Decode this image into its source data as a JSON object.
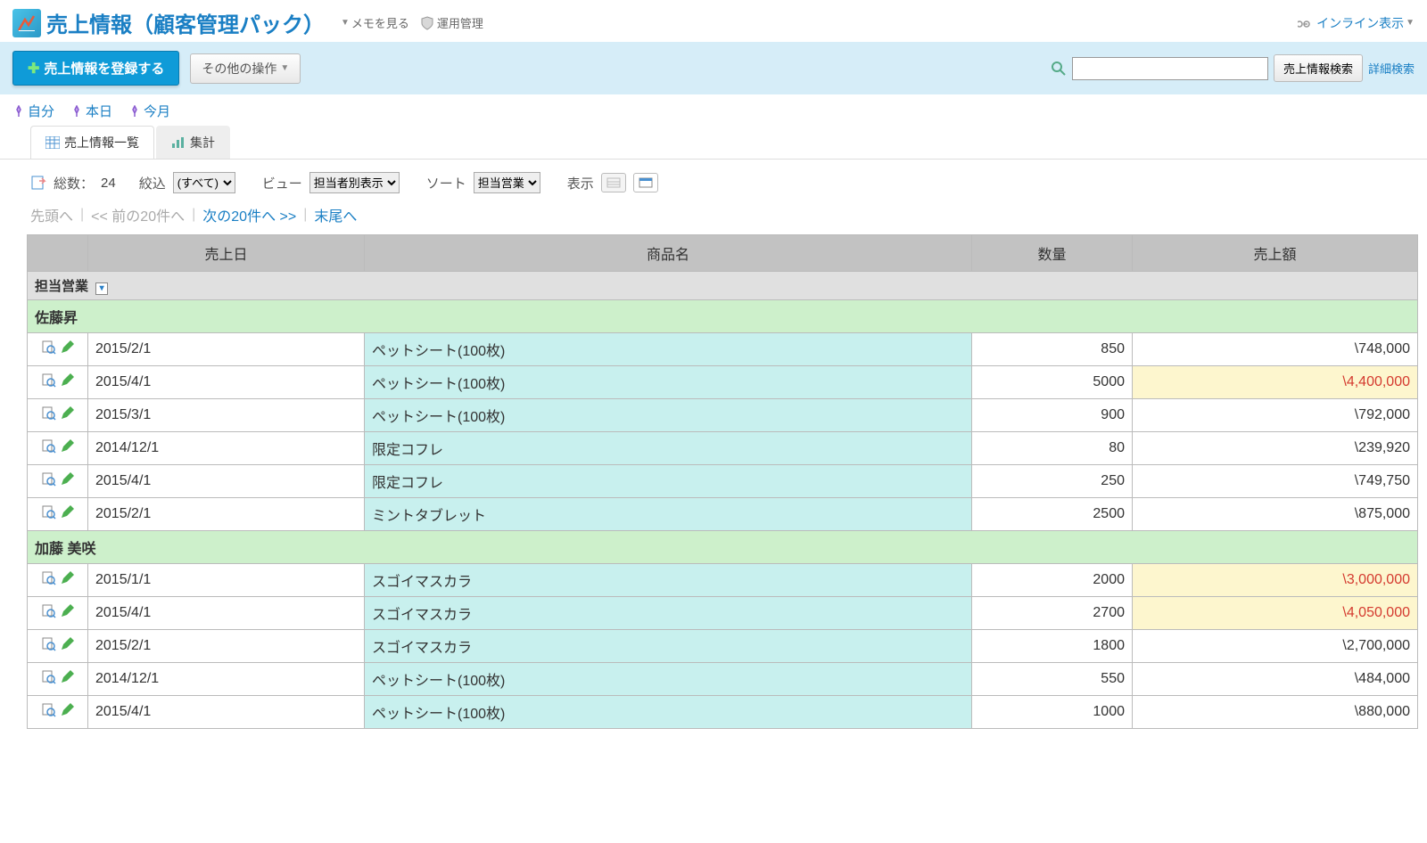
{
  "header": {
    "title": "売上情報（顧客管理パック）",
    "memo_label": "メモを見る",
    "operation_label": "運用管理",
    "inline_label": "インライン表示"
  },
  "toolbar": {
    "register_label": "売上情報を登録する",
    "other_ops_label": "その他の操作",
    "search_button": "売上情報検索",
    "adv_search": "詳細検索"
  },
  "pins": [
    {
      "label": "自分"
    },
    {
      "label": "本日"
    },
    {
      "label": "今月"
    }
  ],
  "tabs": [
    {
      "label": "売上情報一覧"
    },
    {
      "label": "集計"
    }
  ],
  "controls": {
    "total_label": "総数：",
    "total_value": "24",
    "filter_label": "絞込",
    "filter_options": [
      "(すべて)"
    ],
    "view_label": "ビュー",
    "view_options": [
      "担当者別表示"
    ],
    "sort_label": "ソート",
    "sort_options": [
      "担当営業"
    ],
    "display_label": "表示"
  },
  "pager": {
    "first": "先頭へ",
    "prev": "<< 前の20件へ",
    "next": "次の20件へ >>",
    "last": "末尾へ"
  },
  "table": {
    "group_by": "担当営業",
    "columns": [
      "売上日",
      "商品名",
      "数量",
      "売上額"
    ],
    "groups": [
      {
        "name": "佐藤昇",
        "rows": [
          {
            "date": "2015/2/1",
            "product": "ペットシート(100枚)",
            "qty": "850",
            "amount": "\\748,000",
            "hot": false
          },
          {
            "date": "2015/4/1",
            "product": "ペットシート(100枚)",
            "qty": "5000",
            "amount": "\\4,400,000",
            "hot": true
          },
          {
            "date": "2015/3/1",
            "product": "ペットシート(100枚)",
            "qty": "900",
            "amount": "\\792,000",
            "hot": false
          },
          {
            "date": "2014/12/1",
            "product": "限定コフレ",
            "qty": "80",
            "amount": "\\239,920",
            "hot": false
          },
          {
            "date": "2015/4/1",
            "product": "限定コフレ",
            "qty": "250",
            "amount": "\\749,750",
            "hot": false
          },
          {
            "date": "2015/2/1",
            "product": "ミントタブレット",
            "qty": "2500",
            "amount": "\\875,000",
            "hot": false
          }
        ]
      },
      {
        "name": "加藤 美咲",
        "rows": [
          {
            "date": "2015/1/1",
            "product": "スゴイマスカラ",
            "qty": "2000",
            "amount": "\\3,000,000",
            "hot": true
          },
          {
            "date": "2015/4/1",
            "product": "スゴイマスカラ",
            "qty": "2700",
            "amount": "\\4,050,000",
            "hot": true
          },
          {
            "date": "2015/2/1",
            "product": "スゴイマスカラ",
            "qty": "1800",
            "amount": "\\2,700,000",
            "hot": false
          },
          {
            "date": "2014/12/1",
            "product": "ペットシート(100枚)",
            "qty": "550",
            "amount": "\\484,000",
            "hot": false
          },
          {
            "date": "2015/4/1",
            "product": "ペットシート(100枚)",
            "qty": "1000",
            "amount": "\\880,000",
            "hot": false
          }
        ]
      }
    ]
  }
}
